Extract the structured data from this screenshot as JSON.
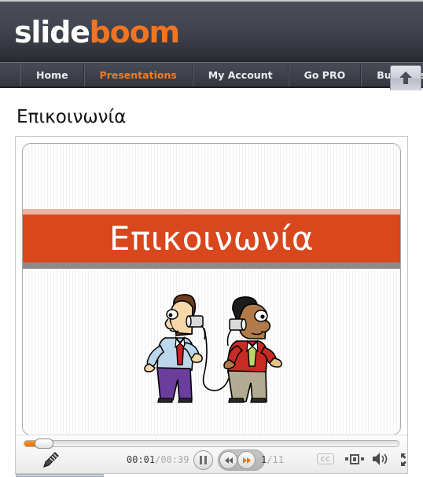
{
  "header": {
    "logo_slide": "slide",
    "logo_boom": "boom",
    "upload_icon": "upload-arrow-icon",
    "accent_orange": "#f07422",
    "bg_dark": "#42454f"
  },
  "nav": {
    "items": [
      {
        "label": "Home",
        "active": false
      },
      {
        "label": "Presentations",
        "active": true
      },
      {
        "label": "My Account",
        "active": false
      },
      {
        "label": "Go PRO",
        "active": false
      },
      {
        "label": "Business",
        "active": false
      }
    ]
  },
  "page": {
    "title": "Επικοινωνία"
  },
  "slide": {
    "banner_text": "Επικοινωνία",
    "banner_color": "#d9471d",
    "banner_top_edge": "#eab3a4",
    "banner_bottom_edge": "#8e8a8a",
    "image_description": "two-men-tin-can-phones-cartoon"
  },
  "player": {
    "progress_percent": 3,
    "time_current": "00:01",
    "time_separator": "/",
    "time_total": "00:39",
    "slide_current": "1",
    "slide_separator": "/",
    "slide_total": "11",
    "buttons": {
      "edit": "pencil-icon",
      "pause": "pause-icon",
      "prev": "rewind-icon",
      "next": "fast-forward-icon",
      "cc": "CC",
      "layout": "layout-icon",
      "volume": "volume-icon",
      "fullscreen": "fullscreen-icon"
    },
    "accent_orange": "#ef6c0a"
  }
}
